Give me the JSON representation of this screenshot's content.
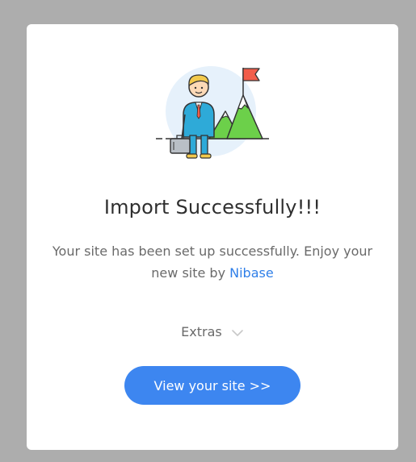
{
  "dialog": {
    "title": "Import Successfully!!!",
    "description": "Your site has been set up successfully. Enjoy your new site by",
    "brand_link": "Nibase",
    "extras_label": "Extras",
    "view_button_label": "View your site >>"
  },
  "icons": {
    "illustration": "success-businessman-mountain-illustration",
    "extras_toggle": "chevron-down-icon"
  },
  "colors": {
    "overlay": "#adadad",
    "card": "#ffffff",
    "primary": "#3d86f0",
    "link": "#2f7fe8",
    "title": "#2f2f2f",
    "text": "#6a6a6a"
  }
}
